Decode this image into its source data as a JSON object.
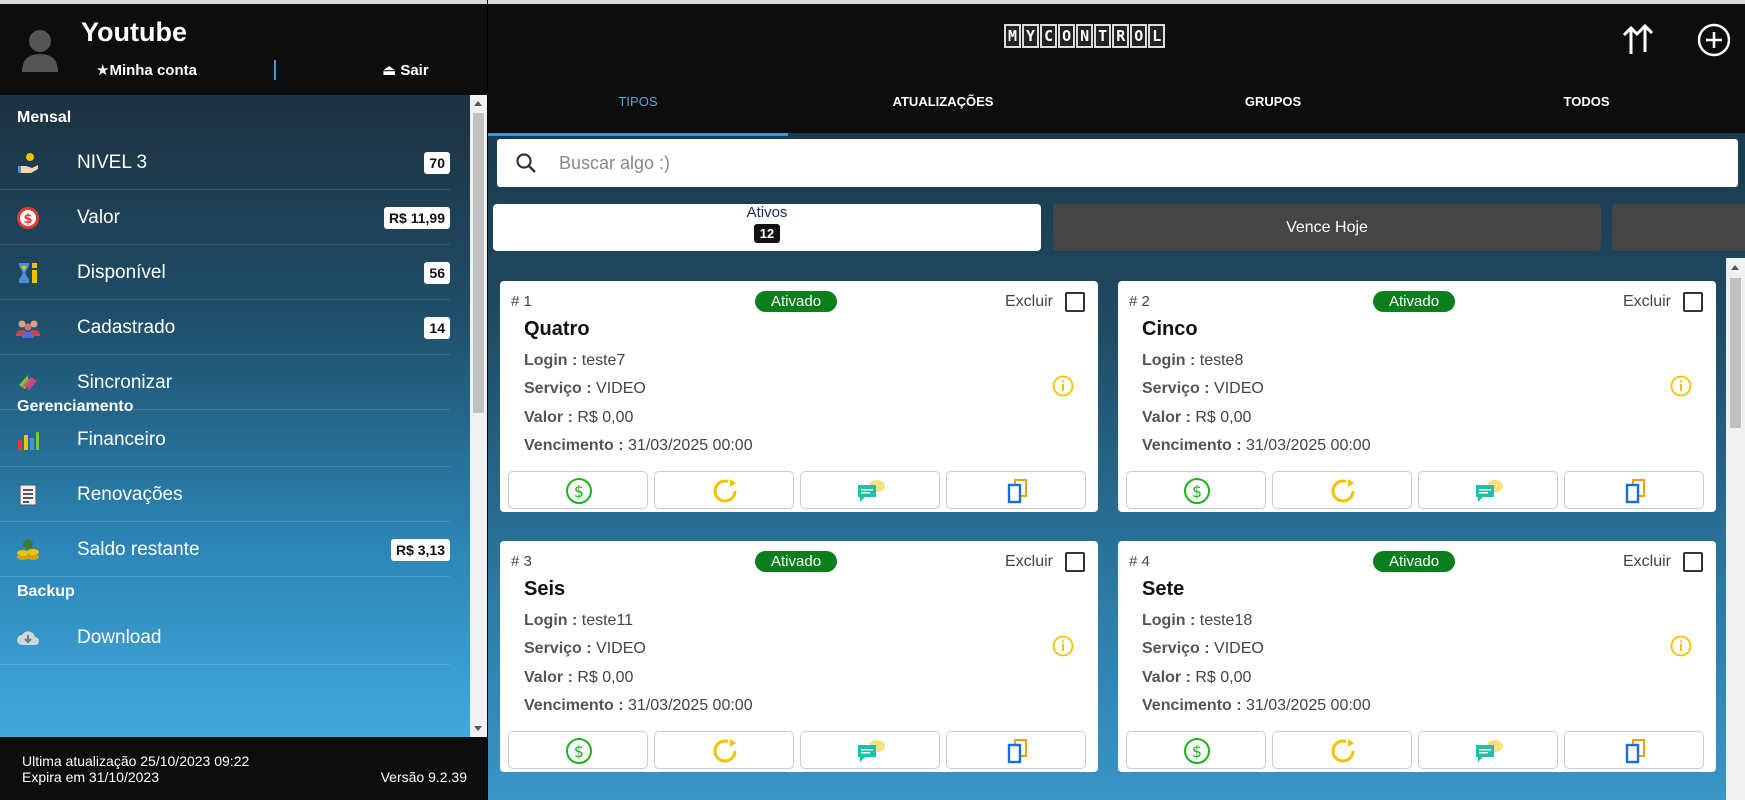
{
  "sidebar": {
    "title": "Youtube",
    "account_label": "★Minha conta",
    "logout_label": "⏏ Sair",
    "sections": [
      {
        "title": "Mensal",
        "items": [
          {
            "label": "NIVEL 3",
            "badge": "70",
            "icon": "hand-coins-icon"
          },
          {
            "label": "Valor",
            "badge": "R$ 11,99",
            "icon": "dollar-circle-icon"
          },
          {
            "label": "Disponível",
            "badge": "56",
            "icon": "hourglass-icon"
          },
          {
            "label": "Cadastrado",
            "badge": "14",
            "icon": "users-icon"
          },
          {
            "label": "Sincronizar",
            "badge": "",
            "icon": "sync-arrows-icon"
          }
        ]
      },
      {
        "title": "Gerenciamento",
        "items": [
          {
            "label": "Financeiro",
            "badge": "",
            "icon": "bar-chart-icon"
          },
          {
            "label": "Renovações",
            "badge": "",
            "icon": "document-list-icon"
          },
          {
            "label": "Saldo restante",
            "badge": "R$ 3,13",
            "icon": "coins-stack-icon"
          }
        ]
      },
      {
        "title": "Backup",
        "items": [
          {
            "label": "Download",
            "badge": "",
            "icon": "cloud-download-icon"
          }
        ]
      }
    ],
    "footer": {
      "last_update": "Ultima atualização 25/10/2023 09:22",
      "expires": "Expira em 31/10/2023",
      "version": "Versão 9.2.39"
    }
  },
  "header": {
    "logo_letters": [
      "M",
      "Y",
      "C",
      "O",
      "N",
      "T",
      "R",
      "O",
      "L"
    ],
    "logo_icon": "mycontrol-logo",
    "actions": [
      "sort-arrows-icon",
      "add-circle-icon"
    ]
  },
  "tabs": [
    {
      "label": "TIPOS",
      "active": true
    },
    {
      "label": "ATUALIZAÇÕES",
      "active": false
    },
    {
      "label": "GRUPOS",
      "active": false
    },
    {
      "label": "TODOS",
      "active": false
    }
  ],
  "search": {
    "placeholder": "Buscar algo :)",
    "value": ""
  },
  "filters": {
    "ativos_label": "Ativos",
    "ativos_count": "12",
    "vence_hoje_label": "Vence Hoje"
  },
  "card_labels": {
    "excluir": "Excluir",
    "login": "Login :",
    "servico": "Serviço :",
    "valor": "Valor :",
    "vencimento": "Vencimento :"
  },
  "cards": [
    {
      "num": "# 1",
      "status": "Ativado",
      "name": "Quatro",
      "login": "teste7",
      "servico": "VIDEO",
      "valor": "R$ 0,00",
      "vencimento": "31/03/2025 00:00"
    },
    {
      "num": "# 2",
      "status": "Ativado",
      "name": "Cinco",
      "login": "teste8",
      "servico": "VIDEO",
      "valor": "R$ 0,00",
      "vencimento": "31/03/2025 00:00"
    },
    {
      "num": "# 3",
      "status": "Ativado",
      "name": "Seis",
      "login": "teste11",
      "servico": "VIDEO",
      "valor": "R$ 0,00",
      "vencimento": "31/03/2025 00:00"
    },
    {
      "num": "# 4",
      "status": "Ativado",
      "name": "Sete",
      "login": "teste18",
      "servico": "VIDEO",
      "valor": "R$ 0,00",
      "vencimento": "31/03/2025 00:00"
    }
  ],
  "colors": {
    "accent": "#3a9ad9",
    "status_active": "#0b7f1b",
    "icon_green": "#1db31d",
    "icon_yellow": "#f2c200",
    "icon_blue": "#1a6fd6"
  }
}
